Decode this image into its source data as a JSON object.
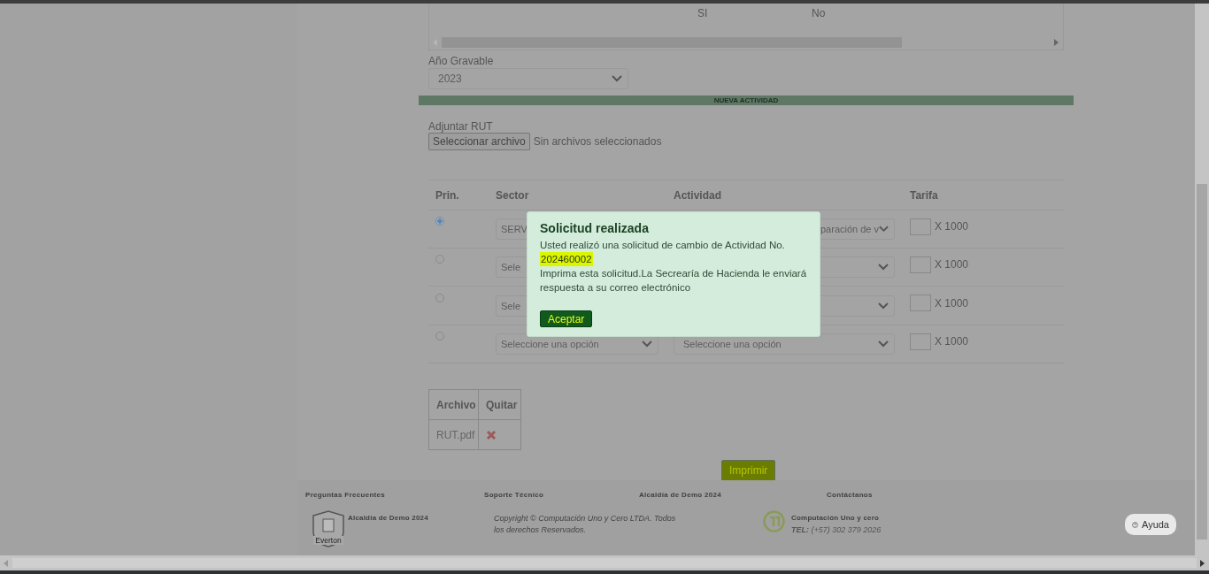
{
  "top_table": {
    "columns": [
      "SI",
      "No"
    ]
  },
  "tax_year": {
    "label": "Año Gravable",
    "value": "2023"
  },
  "section_bar": {
    "title": "NUEVA ACTIVIDAD"
  },
  "rut": {
    "label": "Adjuntar RUT",
    "button": "Seleccionar archivo",
    "status": "Sin archivos seleccionados"
  },
  "activities": {
    "columns": [
      "Prin.",
      "Sector",
      "Actividad",
      "Tarifa"
    ],
    "rows": [
      {
        "selected": true,
        "covered": true,
        "sector": "SERV",
        "actividad": "paración de v",
        "unit": "X 1000"
      },
      {
        "selected": false,
        "sector": "Sele",
        "unit": "X 1000"
      },
      {
        "selected": false,
        "sector": "Sele",
        "unit": "X 1000"
      },
      {
        "selected": false,
        "covered": false,
        "sector": "Seleccione una opción",
        "actividad": "Seleccione una opción",
        "unit": "X 1000"
      }
    ]
  },
  "files": {
    "columns": [
      "Archivo",
      "Quitar"
    ],
    "rows": [
      {
        "name": "RUT.pdf"
      }
    ]
  },
  "print_button": "Imprimir",
  "footer": {
    "headings": [
      "Preguntas Frecuentes",
      "Soporte Técnico",
      "Alcaldía de Demo 2024",
      "Contáctanos"
    ],
    "crest_text": "Everton",
    "org": "Alcaldia de Demo 2024",
    "copyright": "Copyright © Computación Uno y Cero LTDA. Todos los derechos Reservados.",
    "company": "Computación Uno y cero",
    "phone_label": "TEL:",
    "phone": "(+57) 302 379 2026"
  },
  "help_button": "Ayuda",
  "dialog": {
    "title": "Solicitud realizada",
    "intro": "Usted realizó una solicitud de cambio de Actividad No.",
    "number": "202460002",
    "message": "Imprima esta solicitud.La Secrearía de Hacienda le enviará respuesta a su correo electrónico",
    "button": "Aceptar"
  }
}
